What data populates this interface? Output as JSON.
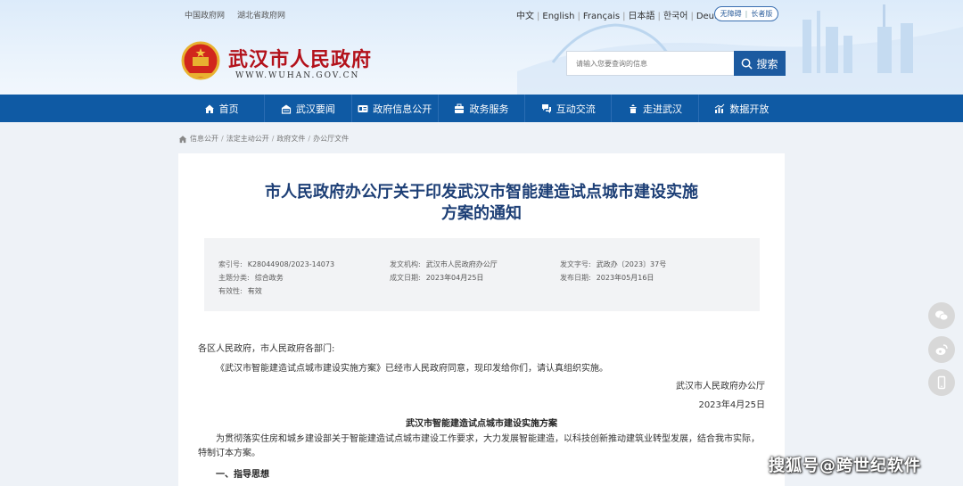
{
  "header": {
    "top_links": [
      "中国政府网",
      "湖北省政府网"
    ],
    "languages": [
      "中文",
      "English",
      "Français",
      "日本語",
      "한국어",
      "Deutsch"
    ],
    "accessibility": [
      "无障碍",
      "长者版"
    ],
    "site_title": "武汉市人民政府",
    "site_url": "WWW.WUHAN.GOV.CN",
    "search_placeholder": "请输入您要查询的信息",
    "search_button": "搜索"
  },
  "nav": {
    "items": [
      {
        "label": "首页",
        "icon": "home-icon"
      },
      {
        "label": "武汉要闻",
        "icon": "news-icon"
      },
      {
        "label": "政府信息公开",
        "icon": "info-icon"
      },
      {
        "label": "政务服务",
        "icon": "service-icon"
      },
      {
        "label": "互动交流",
        "icon": "interaction-icon"
      },
      {
        "label": "走进武汉",
        "icon": "city-icon"
      },
      {
        "label": "数据开放",
        "icon": "data-icon"
      }
    ]
  },
  "breadcrumb": [
    "信息公开",
    "法定主动公开",
    "政府文件",
    "办公厅文件"
  ],
  "article": {
    "title_line1": "市人民政府办公厅关于印发武汉市智能建造试点城市建设实施",
    "title_line2": "方案的通知",
    "meta": {
      "index_label": "索引号:",
      "index_value": "K28044908/2023-14073",
      "org_label": "发文机构:",
      "org_value": "武汉市人民政府办公厅",
      "docno_label": "发文字号:",
      "docno_value": "武政办〔2023〕37号",
      "topic_label": "主题分类:",
      "topic_value": "综合政务",
      "created_label": "成文日期:",
      "created_value": "2023年04月25日",
      "published_label": "发布日期:",
      "published_value": "2023年05月16日",
      "validity_label": "有效性:",
      "validity_value": "有效"
    },
    "salutation": "各区人民政府，市人民政府各部门:",
    "line1": "《武汉市智能建造试点城市建设实施方案》已经市人民政府同意，现印发给你们，请认真组织实施。",
    "sign_org": "武汉市人民政府办公厅",
    "sign_date": "2023年4月25日",
    "doc_subtitle": "武汉市智能建造试点城市建设实施方案",
    "para1": "为贯彻落实住房和城乡建设部关于智能建造试点城市建设工作要求，大力发展智能建造，以科技创新推动建筑业转型发展，结合我市实际，特制订本方案。",
    "section1": "一、指导思想"
  },
  "side_share": [
    "wechat-icon",
    "weibo-icon",
    "mobile-icon"
  ],
  "watermark": "搜狐号@跨世纪软件",
  "colors": {
    "nav_blue": "#0f5aa4",
    "title_red": "#b3121b",
    "article_title": "#1d3f76",
    "search_button": "#1c5aa0"
  }
}
